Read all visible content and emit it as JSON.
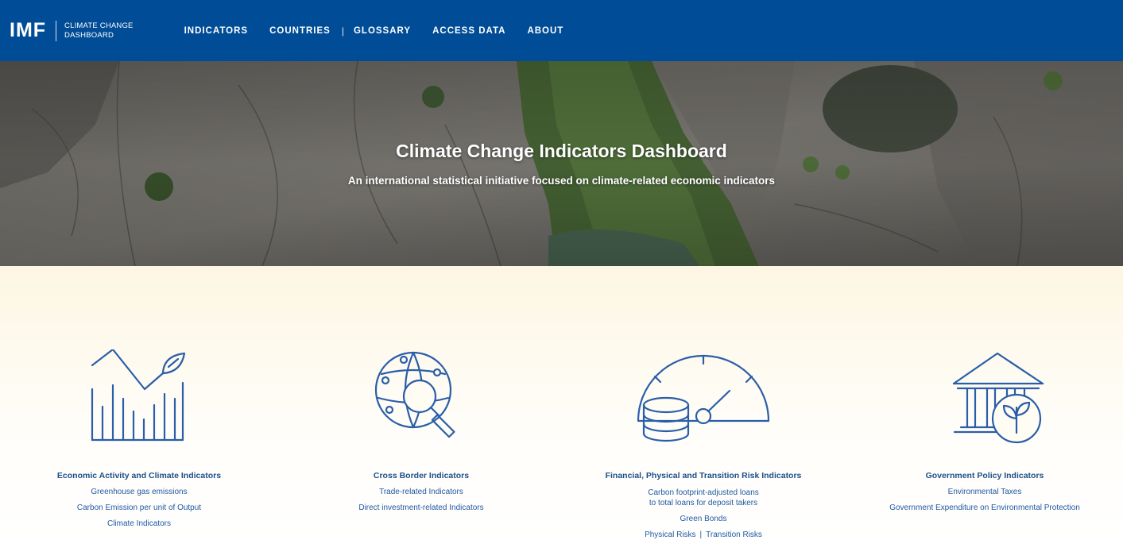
{
  "nav": {
    "logo": {
      "imf": "IMF",
      "line1": "CLIMATE CHANGE",
      "line2": "DASHBOARD"
    },
    "items": [
      "INDICATORS",
      "COUNTRIES",
      "GLOSSARY",
      "ACCESS DATA",
      "ABOUT"
    ],
    "separator": "|"
  },
  "hero": {
    "title": "Climate Change Indicators Dashboard",
    "subtitle": "An international statistical initiative focused on climate-related economic indicators"
  },
  "categories": [
    {
      "icon": "chart-leaf-icon",
      "title": "Economic Activity and Climate Indicators",
      "links": [
        "Greenhouse gas emissions",
        "Carbon Emission per unit of Output",
        "Climate Indicators"
      ]
    },
    {
      "icon": "globe-magnifier-icon",
      "title": "Cross Border Indicators",
      "links": [
        "Trade-related Indicators",
        "Direct investment-related Indicators"
      ]
    },
    {
      "icon": "gauge-coins-icon",
      "title": "Financial, Physical and Transition Risk Indicators",
      "link_multi": {
        "line1": "Carbon footprint-adjusted loans",
        "line2": "to total loans for deposit takers"
      },
      "links": [
        "Green Bonds"
      ],
      "inline": {
        "a": "Physical Risks",
        "sep": "|",
        "b": "Transition Risks"
      }
    },
    {
      "icon": "bank-leaf-icon",
      "title": "Government Policy Indicators",
      "links": [
        "Environmental Taxes",
        "Government Expenditure on Environmental Protection"
      ]
    }
  ],
  "colors": {
    "nav": "#004c97",
    "icon_stroke": "#2a5ea8",
    "link": "#1f5aa0",
    "title": "#1b4f8a"
  }
}
